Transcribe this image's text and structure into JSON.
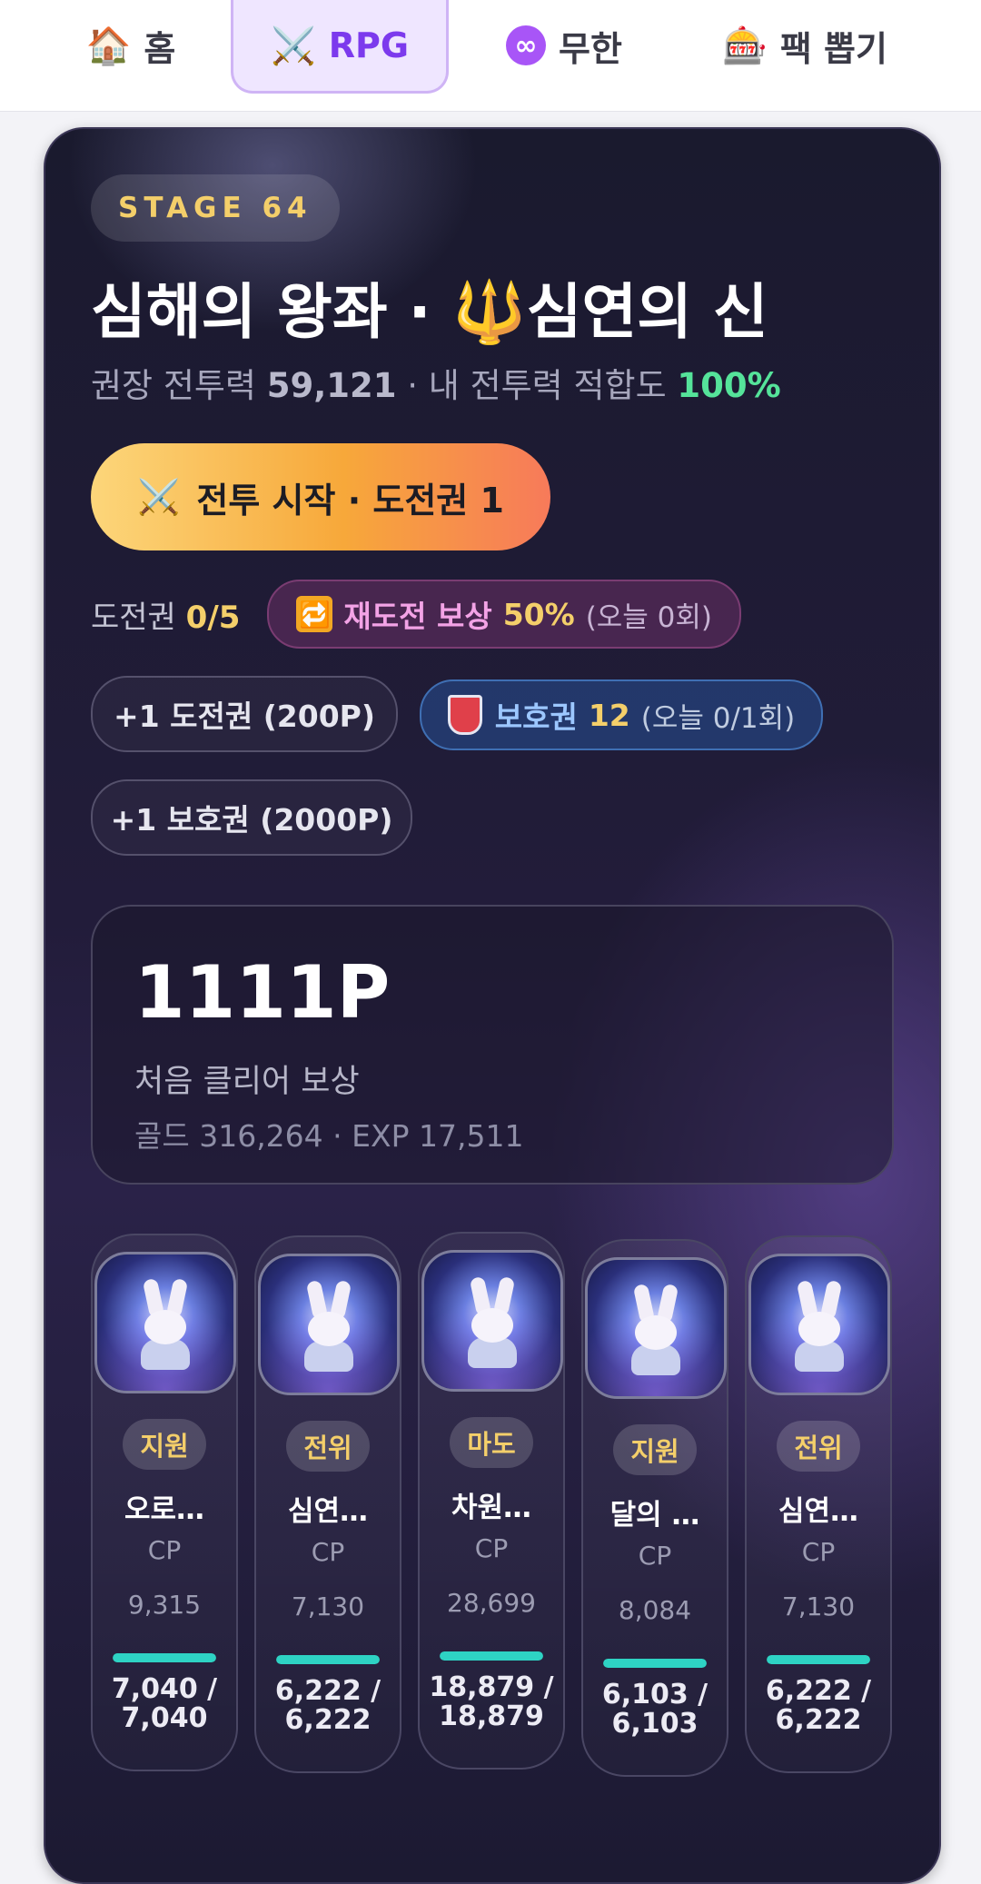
{
  "nav": {
    "tabs": [
      {
        "icon": "🏠",
        "icon_name": "house-icon",
        "label": "홈",
        "active": false
      },
      {
        "icon": "⚔️",
        "icon_name": "crossed-swords-icon",
        "label": "RPG",
        "active": true
      },
      {
        "icon": "∞",
        "icon_name": "infinity-icon",
        "label": "무한",
        "active": false
      },
      {
        "icon": "🎰",
        "icon_name": "slot-machine-icon",
        "label": "팩 뽑기",
        "active": false
      }
    ]
  },
  "stage": {
    "badge": "STAGE 64",
    "title_prefix": "심해의 왕좌 · ",
    "title_icon": "🔱",
    "title_suffix": "심연의 신",
    "power_prefix": "권장 전투력",
    "power_value": "59,121",
    "power_mid": "· 내 전투력 적합도",
    "power_fit": "100%"
  },
  "battle_button": {
    "icon": "⚔️",
    "label": "전투 시작 · 도전권 1"
  },
  "tickets": {
    "label": "도전권",
    "value": "0/5",
    "retry": {
      "icon": "🔁",
      "label": "재도전 보상",
      "percent": "50%",
      "sub": "(오늘 0회)"
    }
  },
  "buy_ticket_label": "+1 도전권 (200P)",
  "shield": {
    "label": "보호권",
    "count": "12",
    "sub": "(오늘 0/1회)"
  },
  "buy_shield_label": "+1 보호권 (2000P)",
  "reward": {
    "amount": "1111P",
    "desc": "처음 클리어 보상",
    "detail": "골드 316,264 · EXP 17,511"
  },
  "heroes": [
    {
      "role": "지원",
      "name": "오로…",
      "cp_label": "CP",
      "cp": "9,315",
      "hp": "7,040 / 7,040",
      "hp_fraction": 1.0
    },
    {
      "role": "전위",
      "name": "심연…",
      "cp_label": "CP",
      "cp": "7,130",
      "hp": "6,222 / 6,222",
      "hp_fraction": 1.0
    },
    {
      "role": "마도",
      "name": "차원…",
      "cp_label": "CP",
      "cp": "28,699",
      "hp": "18,879 / 18,879",
      "hp_fraction": 1.0
    },
    {
      "role": "지원",
      "name": "달의 …",
      "cp_label": "CP",
      "cp": "8,084",
      "hp": "6,103 / 6,103",
      "hp_fraction": 1.0
    },
    {
      "role": "전위",
      "name": "심연…",
      "cp_label": "CP",
      "cp": "7,130",
      "hp": "6,222 / 6,222",
      "hp_fraction": 1.0
    }
  ],
  "colors": {
    "accent_gold": "#f4cf6a",
    "fit_green": "#55e39a",
    "hp_teal": "#2ed3c4",
    "nav_active": "#7c3aed"
  }
}
